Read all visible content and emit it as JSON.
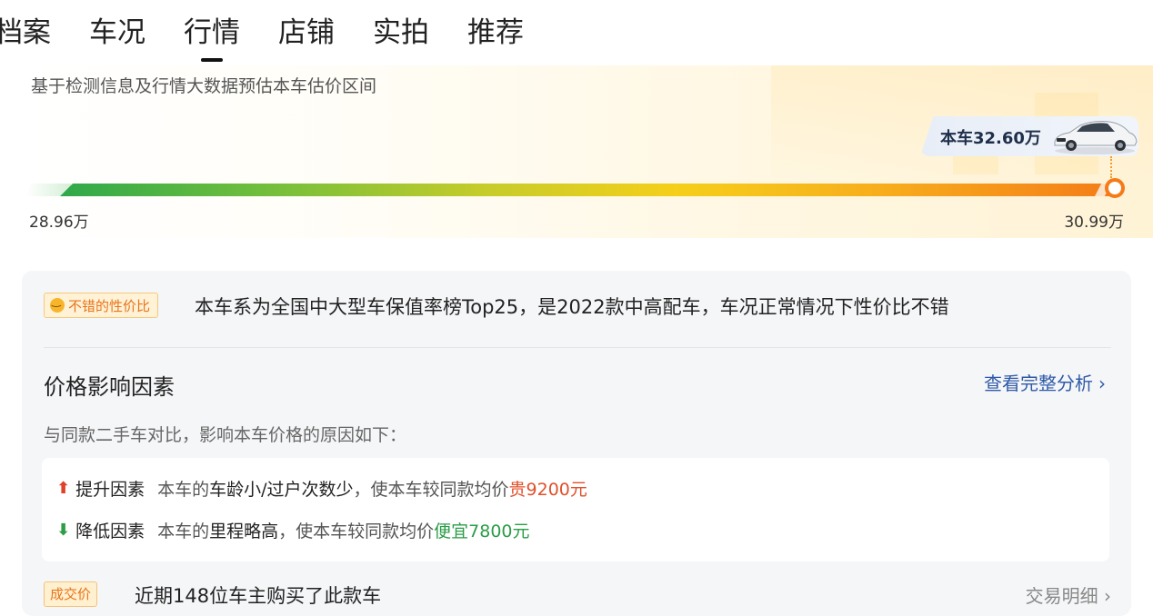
{
  "tabs": [
    "档案",
    "车况",
    "行情",
    "店铺",
    "实拍",
    "推荐"
  ],
  "active_tab": "行情",
  "hero": {
    "subtitle": "基于检测信息及行情大数据预估本车估价区间",
    "car_price_label": "本车32.60万",
    "range_low": "28.96万",
    "range_high": "30.99万"
  },
  "summary": {
    "badge": "不错的性价比",
    "text": "本车系为全国中大型车保值率榜Top25，是2022款中高配车，车况正常情况下性价比不错"
  },
  "factors": {
    "title": "价格影响因素",
    "link": "查看完整分析",
    "subtitle": "与同款二手车对比，影响本车价格的原因如下：",
    "up": {
      "label": "提升因素",
      "prefix": "本车的",
      "strong": "车龄小/过户次数少",
      "mid": "，使本车较同款均价",
      "delta": "贵9200元"
    },
    "down": {
      "label": "降低因素",
      "prefix": "本车的",
      "strong": "里程略高",
      "mid": "，使本车较同款均价",
      "delta": "便宜7800元"
    }
  },
  "deals": {
    "badge": "成交价",
    "text": "近期148位车主购买了此款车",
    "link": "交易明细 ›"
  },
  "colors": {
    "up": "#e0502b",
    "down": "#2a9d47",
    "link": "#2f5aa8",
    "bar_start": "#2fa84a",
    "bar_end": "#f47b18"
  }
}
